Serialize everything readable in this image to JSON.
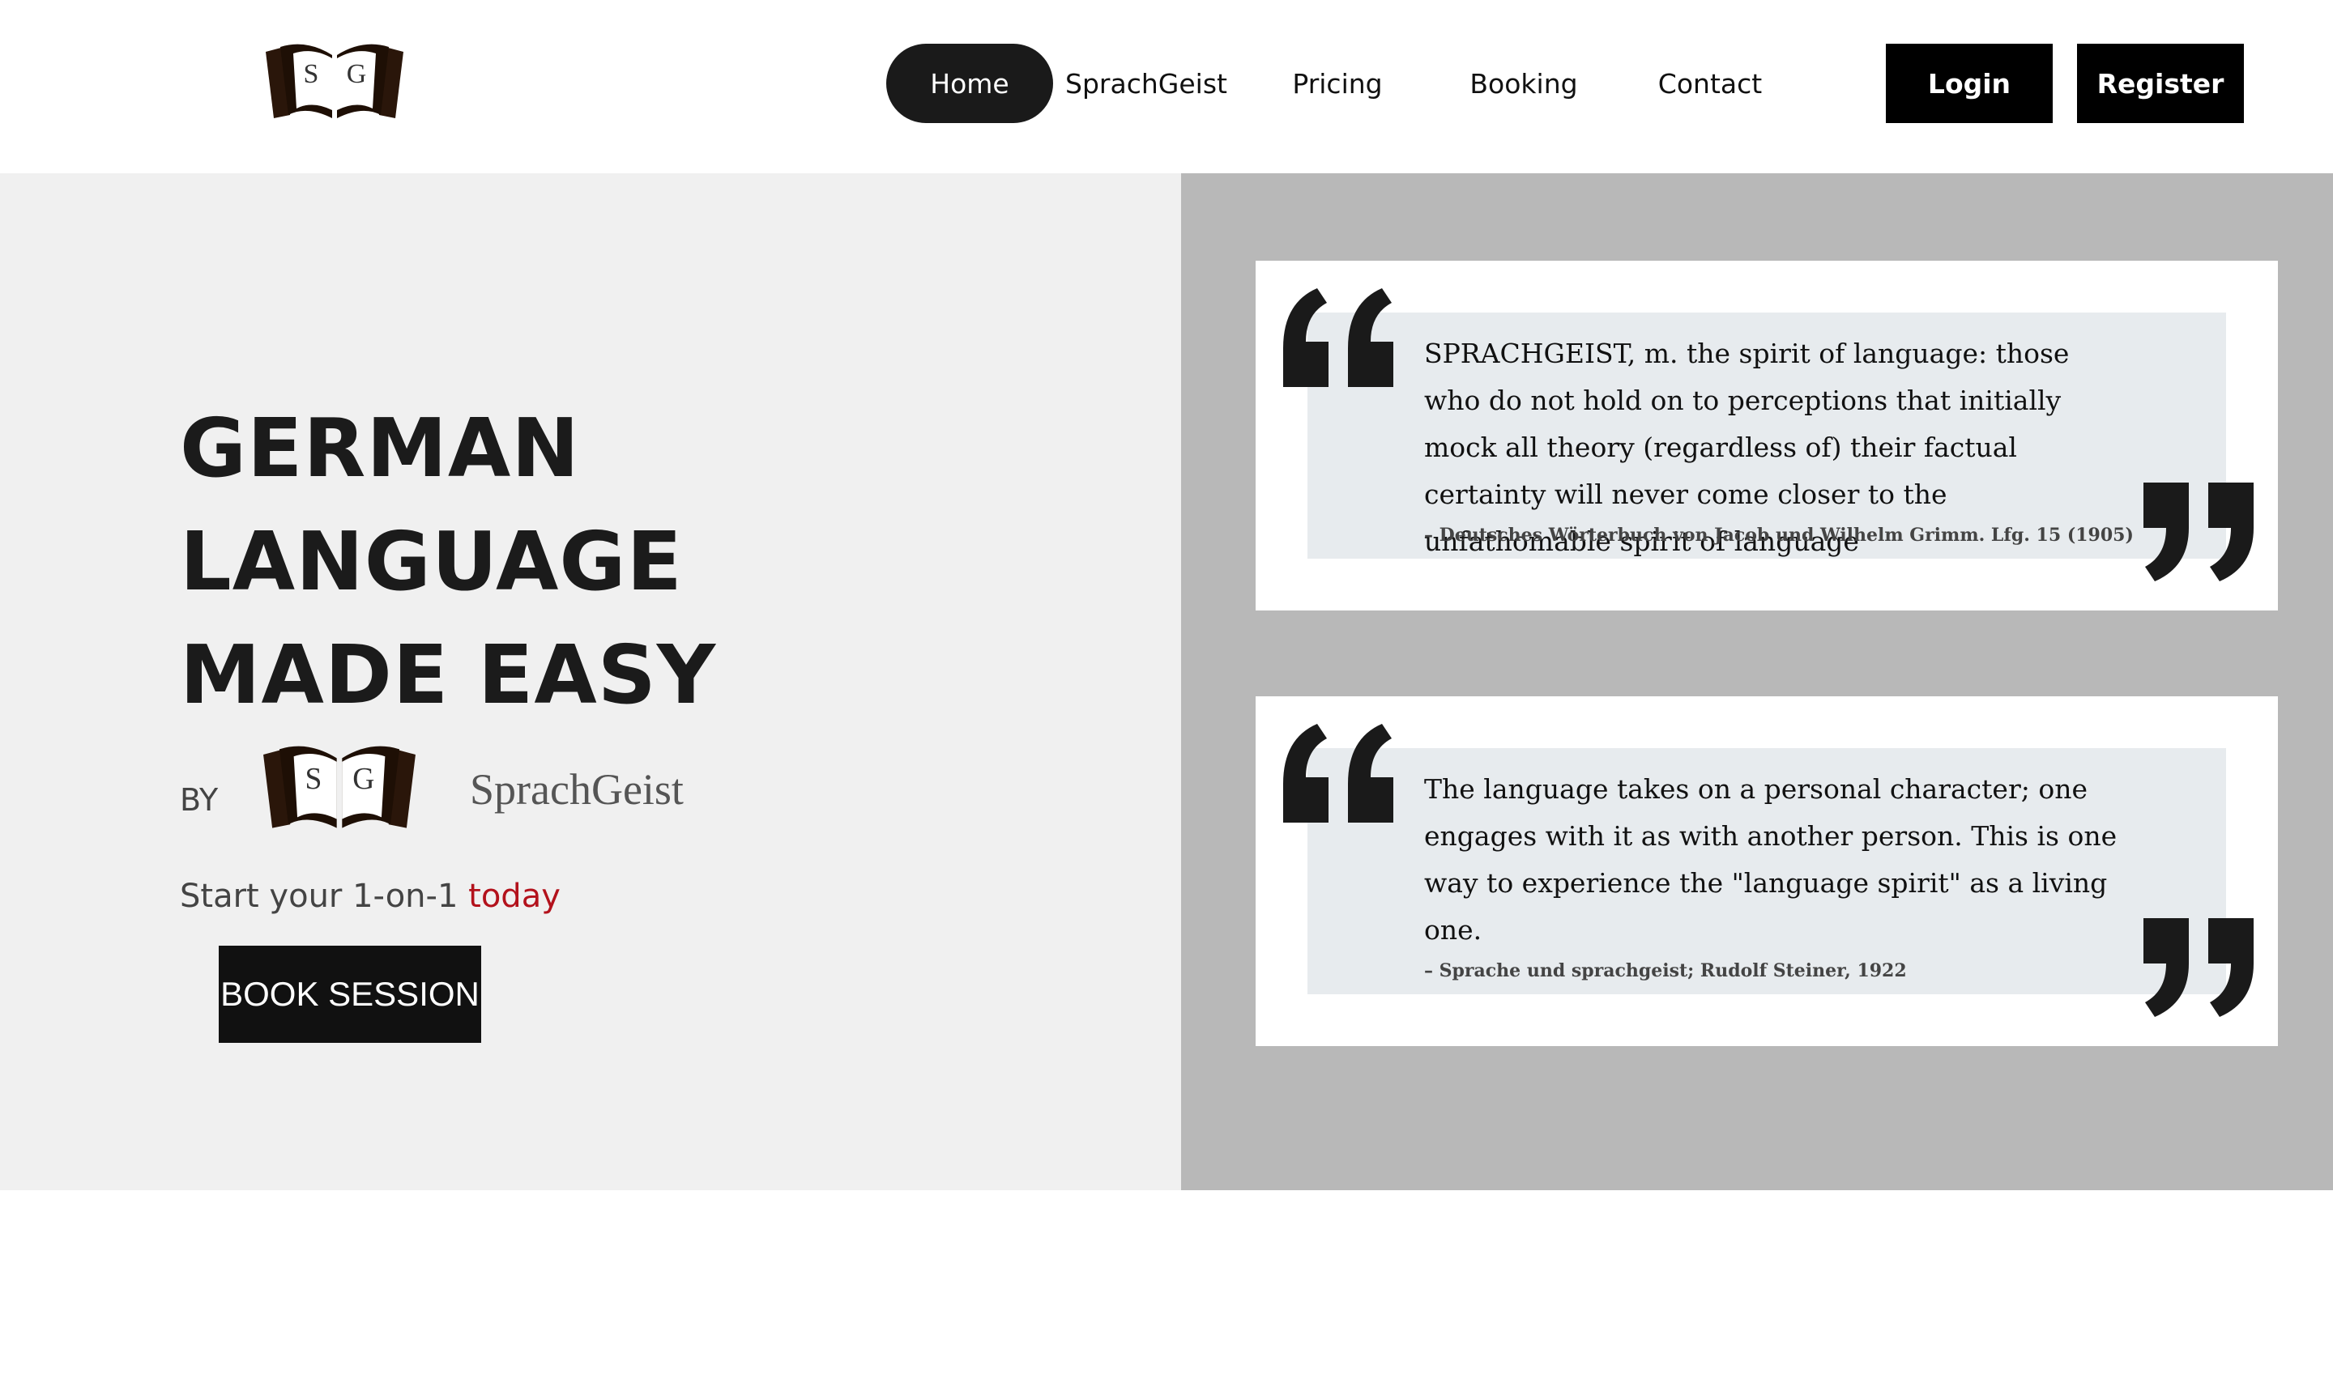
{
  "header": {
    "logo_letters": [
      "S",
      "G"
    ],
    "nav": {
      "home": "Home",
      "sprachgeist": "SprachGeist",
      "pricing": "Pricing",
      "booking": "Booking",
      "contact": "Contact"
    },
    "login_label": "Login",
    "register_label": "Register"
  },
  "hero": {
    "title_lines": [
      "GERMAN",
      "LANGUAGE",
      "MADE EASY"
    ],
    "by_label": "BY",
    "brand_name": "SprachGeist",
    "tagline_start": "Start your 1-on-1",
    "tagline_accent": "today",
    "book_button": "BOOK SESSION"
  },
  "quotes": [
    {
      "text": "SPRACHGEIST, m. the spirit of language: those who do not hold on to perceptions that initially mock all theory (regardless of) their factual certainty will never come closer to the unfathomable spirit of language",
      "source": "–  Deutsches Wörterbuch von Jacob und Wilhelm Grimm. Lfg. 15 (1905)"
    },
    {
      "text": "The language takes on a personal character; one engages with it as with another person. This is one way to experience the \"language spirit\" as a living one.",
      "source": "– Sprache und sprachgeist; Rudolf Steiner, 1922"
    }
  ],
  "colors": {
    "accent_red": "#b3121c",
    "nav_active_bg": "#1a1a1a",
    "hero_left_bg": "#f0f0f0",
    "hero_right_bg": "#b8b8b8",
    "quote_inner_bg": "#e7ebee"
  },
  "icons": {
    "logo": "open-book-logo-icon",
    "quote_open": "open-quote-icon",
    "quote_close": "close-quote-icon"
  }
}
